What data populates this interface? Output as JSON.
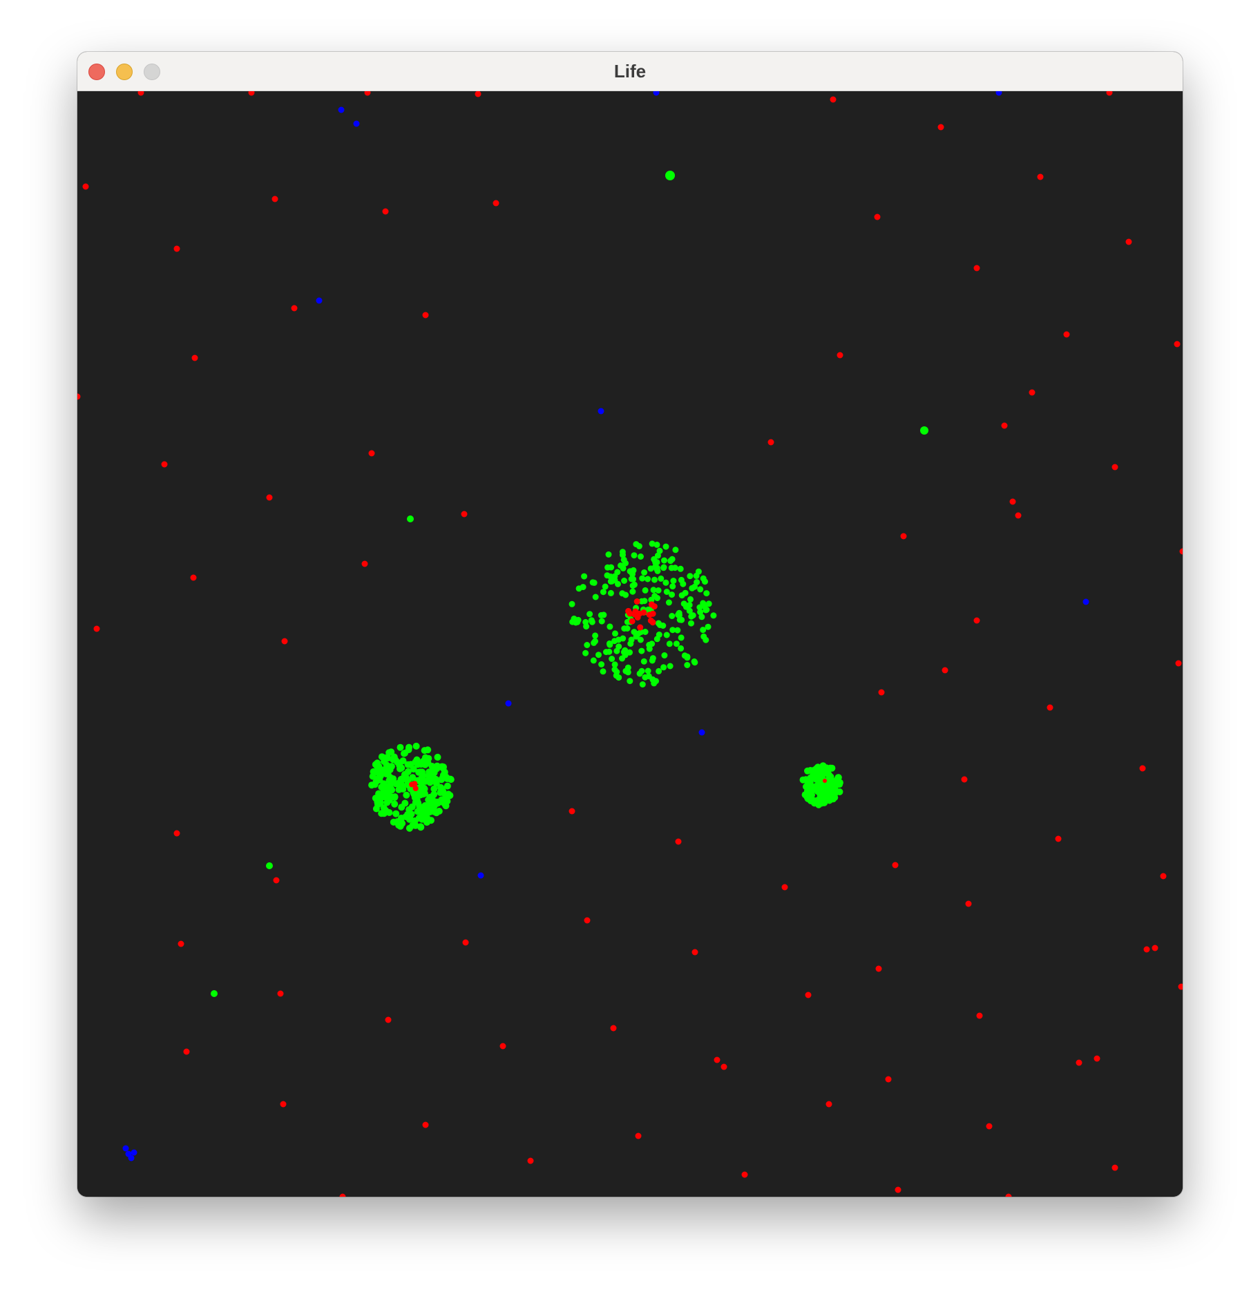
{
  "window": {
    "title": "Life"
  },
  "controls": {
    "close_icon": "close-icon",
    "minimize_icon": "minimize-icon",
    "zoom_icon": "zoom-icon"
  },
  "colors": {
    "window_background": "#202020",
    "titlebar": "#f3f2f0",
    "close": "#ee6a5e",
    "minimize": "#f5bf4f",
    "zoom": "#d5d5d4",
    "red_particles": "#ff0000",
    "green_particles": "#00ff00",
    "blue_particles": "#0000ff"
  },
  "simulation": {
    "particle_types": [
      "red",
      "green",
      "blue"
    ]
  }
}
